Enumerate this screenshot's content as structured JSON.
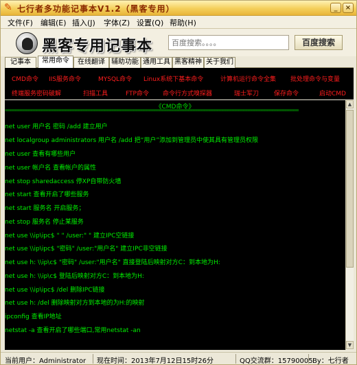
{
  "window": {
    "title": "七行者多功能记事本V1.2（黑客专用）",
    "controls": [
      "_",
      "×"
    ]
  },
  "menu": [
    "文件(F)",
    "编辑(E)",
    "插入(J)",
    "字体(Z)",
    "设置(Q)",
    "帮助(H)"
  ],
  "header": {
    "logo_text": "黑客专用记事本",
    "search_placeholder": "百度搜索。。。。",
    "search_button": "百度搜索"
  },
  "tabs": [
    "记事本",
    "常用命令",
    "在线翻译",
    "辅助功能",
    "通用工具",
    "黑客精神",
    "关于我们"
  ],
  "active_tab": 1,
  "command_links": {
    "row1": [
      "CMD命令",
      "IIS服务命令",
      "MYSQL命令",
      "Linux系统下基本命令",
      "计算机运行命令全集",
      "批处理命令与变量"
    ],
    "row2": [
      "终端服务密码破解",
      "扫描工具",
      "FTP命令",
      "命令行方式嗅探器",
      "瑞士军刀",
      "保存命令",
      "启动CMD"
    ]
  },
  "content": {
    "title": "《CMD命令》",
    "separator": "================================================================================================================",
    "lines": [
      "net user 用户名 密码 /add  建立用户",
      "net localgroup administrators 用户名 /add  把“用户”添加到管理员中使其具有管理员权限",
      "net user  查看有哪些用户",
      "net user 帐户名  查看帐户的属性",
      "net stop sharedaccess   停XP自带防火墙",
      "net start  查看开启了哪些服务",
      "net start 服务名   开启服务；",
      "net stop 服务名  停止某服务",
      "net use \\\\ip\\ipc$ \" \" /user:\" \"  建立IPC空链接",
      "net use \\\\ip\\ipc$ \"密码\" /user:\"用户名\"  建立IPC非空链接",
      "net use h: \\\\ip\\c$ \"密码\" /user:\"用户名\"  直接登陆后映射对方C：到本地为H:",
      "net use h: \\\\ip\\c$  登陆后映射对方C：到本地为H:",
      "net use \\\\ip\\ipc$ /del  删除IPC链接",
      "net use h: /del  删除映射对方到本地的为H:的映射",
      "ipconfig  查看IP地址",
      "netstat -a  查看开启了哪些端口,常用netstat -an"
    ]
  },
  "status": {
    "user": "当前用户：Administrator",
    "time": "现在时间：2013年7月12日15时26分",
    "qq": "QQ交流群：15790005",
    "author": "By：七行者"
  },
  "colors": {
    "titlebar": "#f4cf5a",
    "command_link": "#ff1d1d",
    "content_text": "#00f000",
    "content_bg": "#000000"
  }
}
